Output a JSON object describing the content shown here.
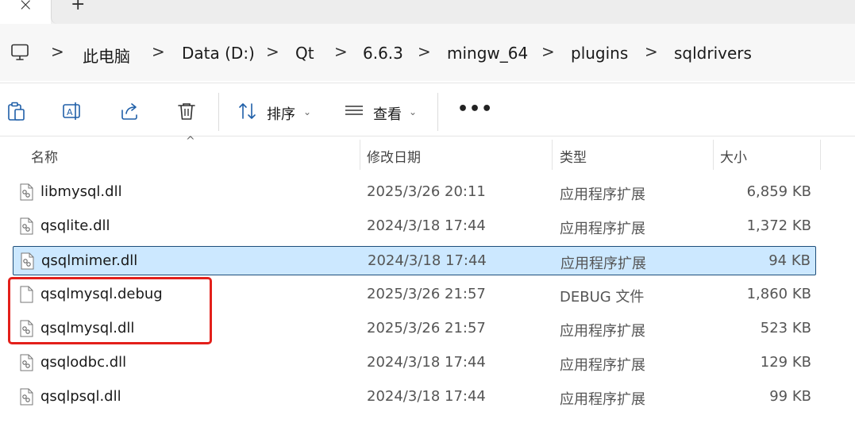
{
  "tabs": {
    "close_glyph": "×",
    "new_glyph": "+"
  },
  "breadcrumb": {
    "items": [
      "此电脑",
      "Data (D:)",
      "Qt",
      "6.6.3",
      "mingw_64",
      "plugins",
      "sqldrivers"
    ],
    "separator": ">"
  },
  "toolbar": {
    "sort_label": "排序",
    "view_label": "查看",
    "caret": "⌄",
    "more": "•••",
    "icons": [
      "paste-icon",
      "rename-icon",
      "share-icon",
      "delete-icon",
      "sort-icon",
      "view-icon",
      "more-icon"
    ]
  },
  "columns": {
    "name": "名称",
    "modified": "修改日期",
    "type": "类型",
    "size": "大小",
    "sort_arrow": "^"
  },
  "files": [
    {
      "name": "libmysql.dll",
      "modified": "2025/3/26 20:11",
      "type": "应用程序扩展",
      "size": "6,859 KB",
      "icon": "dll-icon"
    },
    {
      "name": "qsqlite.dll",
      "modified": "2024/3/18 17:44",
      "type": "应用程序扩展",
      "size": "1,372 KB",
      "icon": "dll-icon"
    },
    {
      "name": "qsqlmimer.dll",
      "modified": "2024/3/18 17:44",
      "type": "应用程序扩展",
      "size": "94 KB",
      "icon": "dll-icon",
      "selected": true
    },
    {
      "name": "qsqlmysql.debug",
      "modified": "2025/3/26 21:57",
      "type": "DEBUG 文件",
      "size": "1,860 KB",
      "icon": "file-icon"
    },
    {
      "name": "qsqlmysql.dll",
      "modified": "2025/3/26 21:57",
      "type": "应用程序扩展",
      "size": "523 KB",
      "icon": "dll-icon"
    },
    {
      "name": "qsqlodbc.dll",
      "modified": "2024/3/18 17:44",
      "type": "应用程序扩展",
      "size": "129 KB",
      "icon": "dll-icon"
    },
    {
      "name": "qsqlpsql.dll",
      "modified": "2024/3/18 17:44",
      "type": "应用程序扩展",
      "size": "99 KB",
      "icon": "dll-icon"
    }
  ],
  "colors": {
    "selection_bg": "#cce8ff",
    "selection_border": "#1e4e7a",
    "annotation": "#e3201b",
    "accent_icon": "#1f5fa8"
  }
}
